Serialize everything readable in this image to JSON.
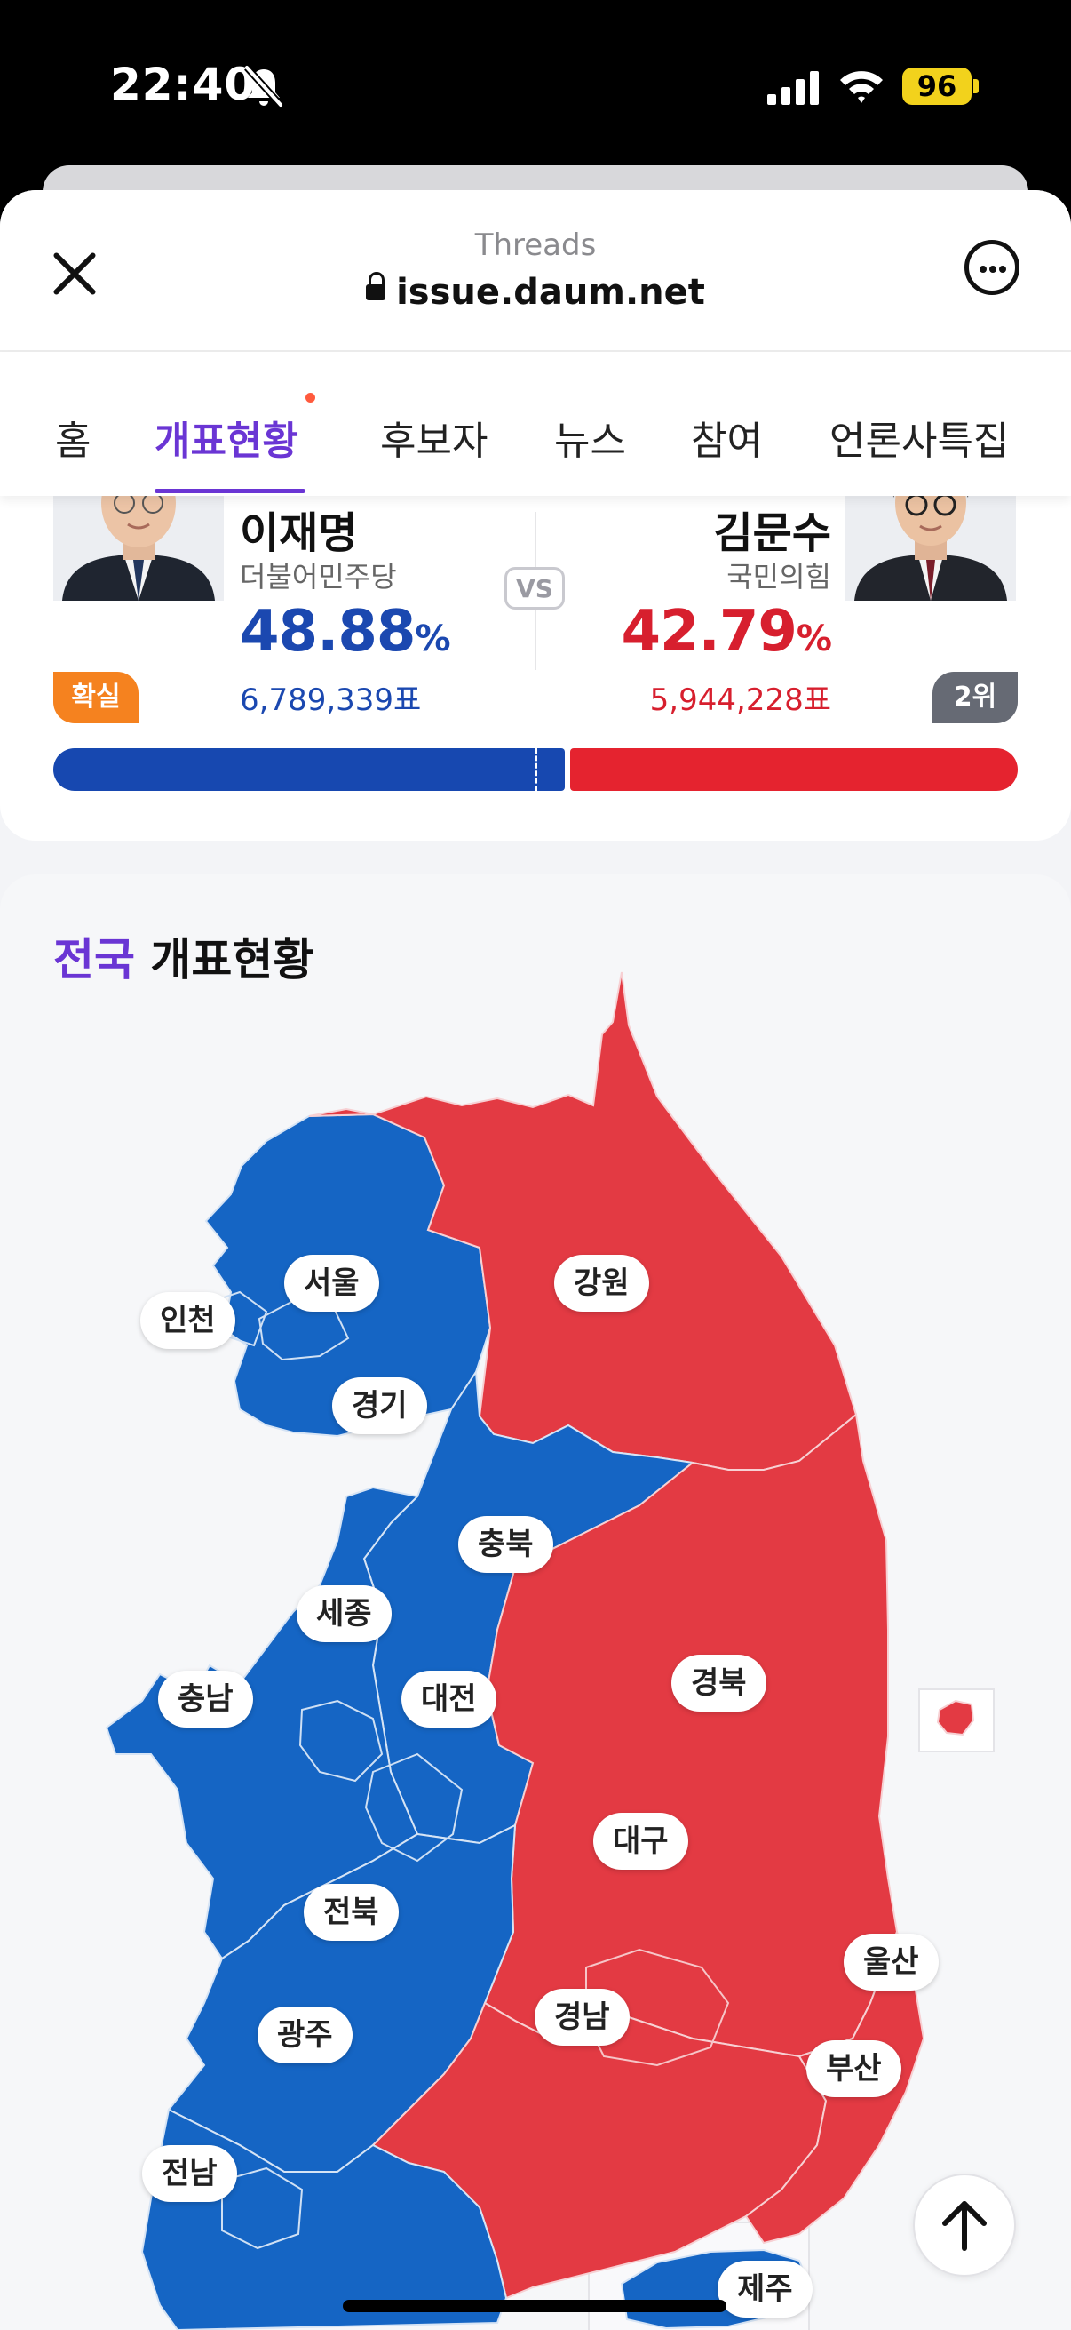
{
  "status_bar": {
    "time": "22:40",
    "battery": "96"
  },
  "browser": {
    "site_name": "Threads",
    "url": "issue.daum.net"
  },
  "tabs": [
    {
      "label": "홈"
    },
    {
      "label": "개표현황"
    },
    {
      "label": "후보자"
    },
    {
      "label": "뉴스"
    },
    {
      "label": "참여"
    },
    {
      "label": "언론사특집"
    }
  ],
  "results": {
    "vs_label": "VS",
    "left": {
      "name": "이재명",
      "party": "더불어민주당",
      "percent": "48.88",
      "percent_unit": "%",
      "votes": "6,789,339표",
      "badge": "확실",
      "color": "#1748b0",
      "share": 0.4888
    },
    "right": {
      "name": "김문수",
      "party": "국민의힘",
      "percent": "42.79",
      "percent_unit": "%",
      "votes": "5,944,228표",
      "badge": "2위",
      "color": "#e5232f",
      "share": 0.4279
    }
  },
  "map": {
    "title_highlight": "전국",
    "title_rest": " 개표현황",
    "colors": {
      "blue": "#1565c4",
      "red": "#e33a43"
    },
    "regions": {
      "seoul": "서울",
      "incheon": "인천",
      "gyeonggi": "경기",
      "gangwon": "강원",
      "chungbuk": "충북",
      "sejong": "세종",
      "chungnam": "충남",
      "daejeon": "대전",
      "gyeongbuk": "경북",
      "daegu": "대구",
      "jeonbuk": "전북",
      "gwangju": "광주",
      "gyeongnam": "경남",
      "ulsan": "울산",
      "busan": "부산",
      "jeonnam": "전남",
      "jeju": "제주"
    }
  }
}
